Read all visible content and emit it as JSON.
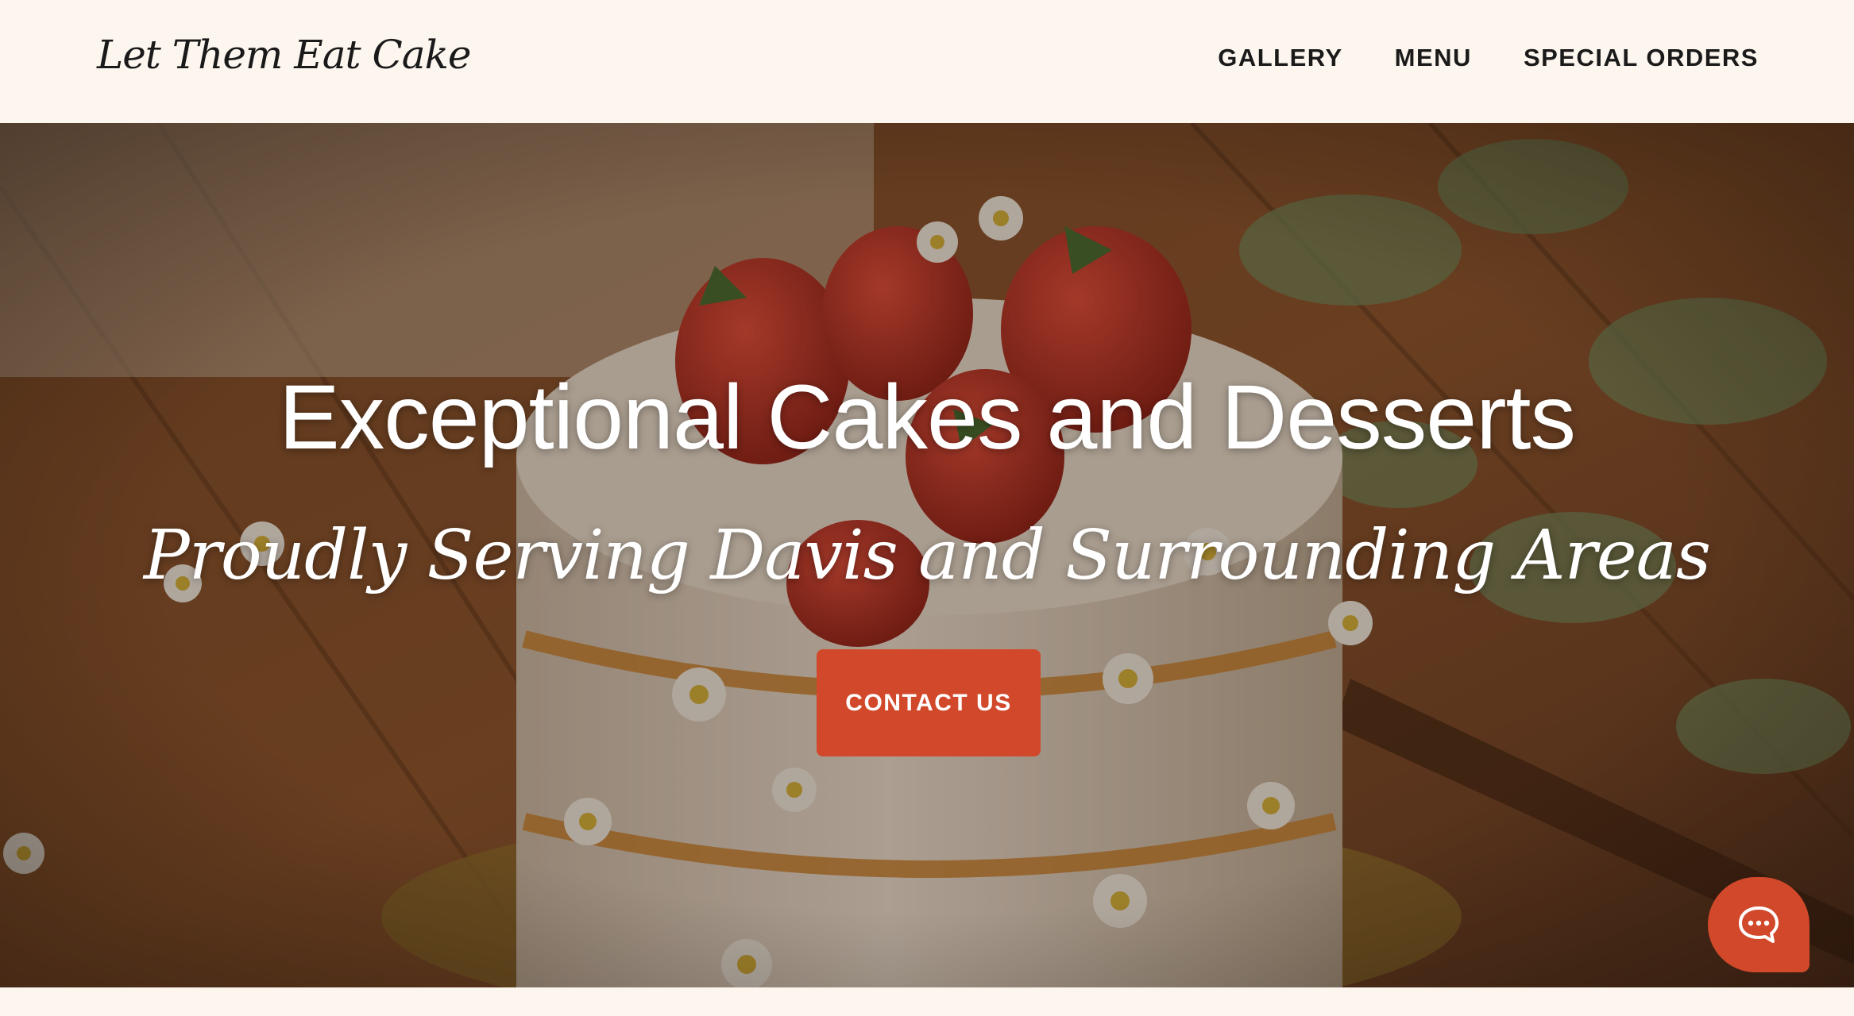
{
  "header": {
    "logo": "Let Them Eat Cake",
    "nav": [
      {
        "label": "GALLERY"
      },
      {
        "label": "MENU"
      },
      {
        "label": "SPECIAL ORDERS"
      }
    ]
  },
  "hero": {
    "title": "Exceptional Cakes and Desserts",
    "subtitle": "Proudly Serving Davis and Surrounding Areas",
    "cta_label": "CONTACT US",
    "background_image": "naked-cake-with-strawberries-and-daisies"
  },
  "chat": {
    "icon": "chat-bubble-icon"
  },
  "colors": {
    "background": "#fcf6ee",
    "accent": "#d2482a",
    "text_dark": "#1a1a1a",
    "hero_text": "#ffffff"
  }
}
